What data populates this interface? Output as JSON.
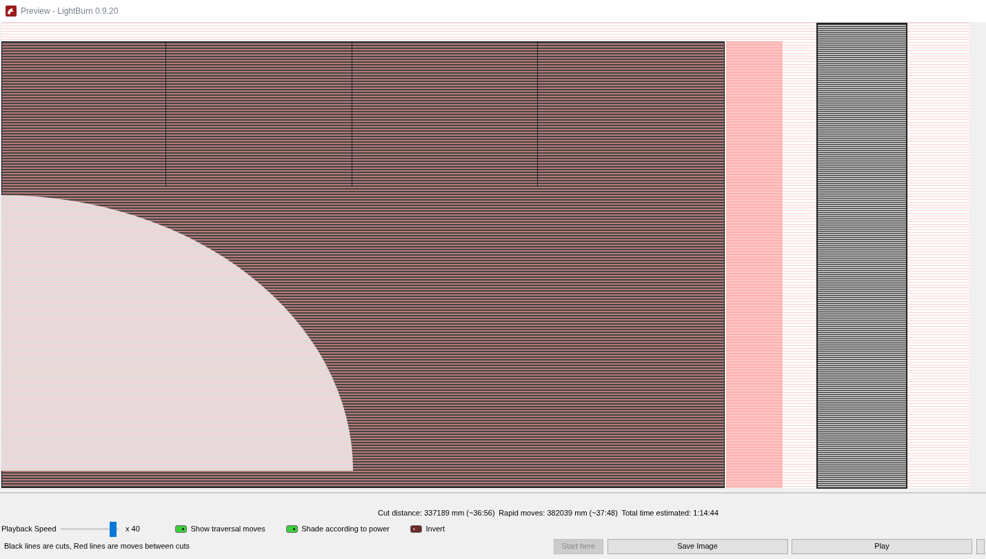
{
  "window": {
    "title": "Preview - LightBurn 0.9.20"
  },
  "stats": {
    "cut_distance": "Cut distance: 337189 mm (~36:56)",
    "rapid_moves": "Rapid moves: 382039 mm (~37:48)",
    "total_time": "Total time estimated: 1:14:44"
  },
  "playback": {
    "label": "Playback Speed",
    "level": 0.92,
    "reading": "x 40"
  },
  "toggles": [
    {
      "label": "Show traversal moves",
      "checked": true
    },
    {
      "label": "Shade according to power",
      "checked": true
    },
    {
      "label": "Invert",
      "checked": false
    }
  ],
  "legend": "Black lines are cuts, Red lines are moves between cuts",
  "buttons": [
    {
      "label": "Start here",
      "disabled": true
    },
    {
      "label": "Save Image",
      "disabled": false
    },
    {
      "label": "Play",
      "disabled": false
    }
  ]
}
